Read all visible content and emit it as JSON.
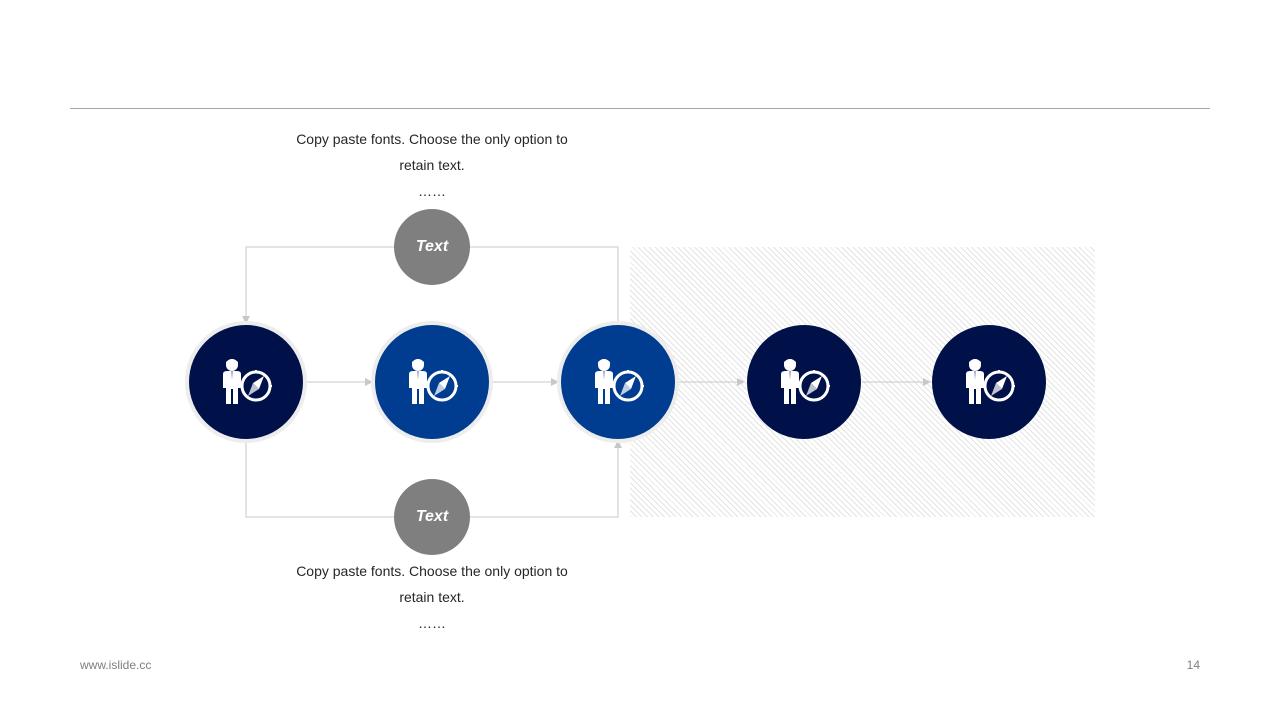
{
  "colors": {
    "dark_navy": "#001049",
    "royal_blue": "#003c8f",
    "gray_bubble": "#7f7f7f",
    "connector": "#c8c8c8",
    "rule": "#a6a6a6"
  },
  "icon": "person-with-compass-icon",
  "top_caption": {
    "text": "Copy paste fonts. Choose the only option to retain text.",
    "ellipsis": "……"
  },
  "bottom_caption": {
    "text": "Copy paste fonts. Choose the only option to retain text.",
    "ellipsis": "……"
  },
  "bubbles": {
    "top_label": "Text",
    "bottom_label": "Text"
  },
  "nodes": [
    {
      "color": "dark_navy"
    },
    {
      "color": "royal_blue"
    },
    {
      "color": "royal_blue"
    },
    {
      "color": "dark_navy"
    },
    {
      "color": "dark_navy"
    }
  ],
  "footer": {
    "website": "www.islide.cc",
    "page_number": "14"
  }
}
